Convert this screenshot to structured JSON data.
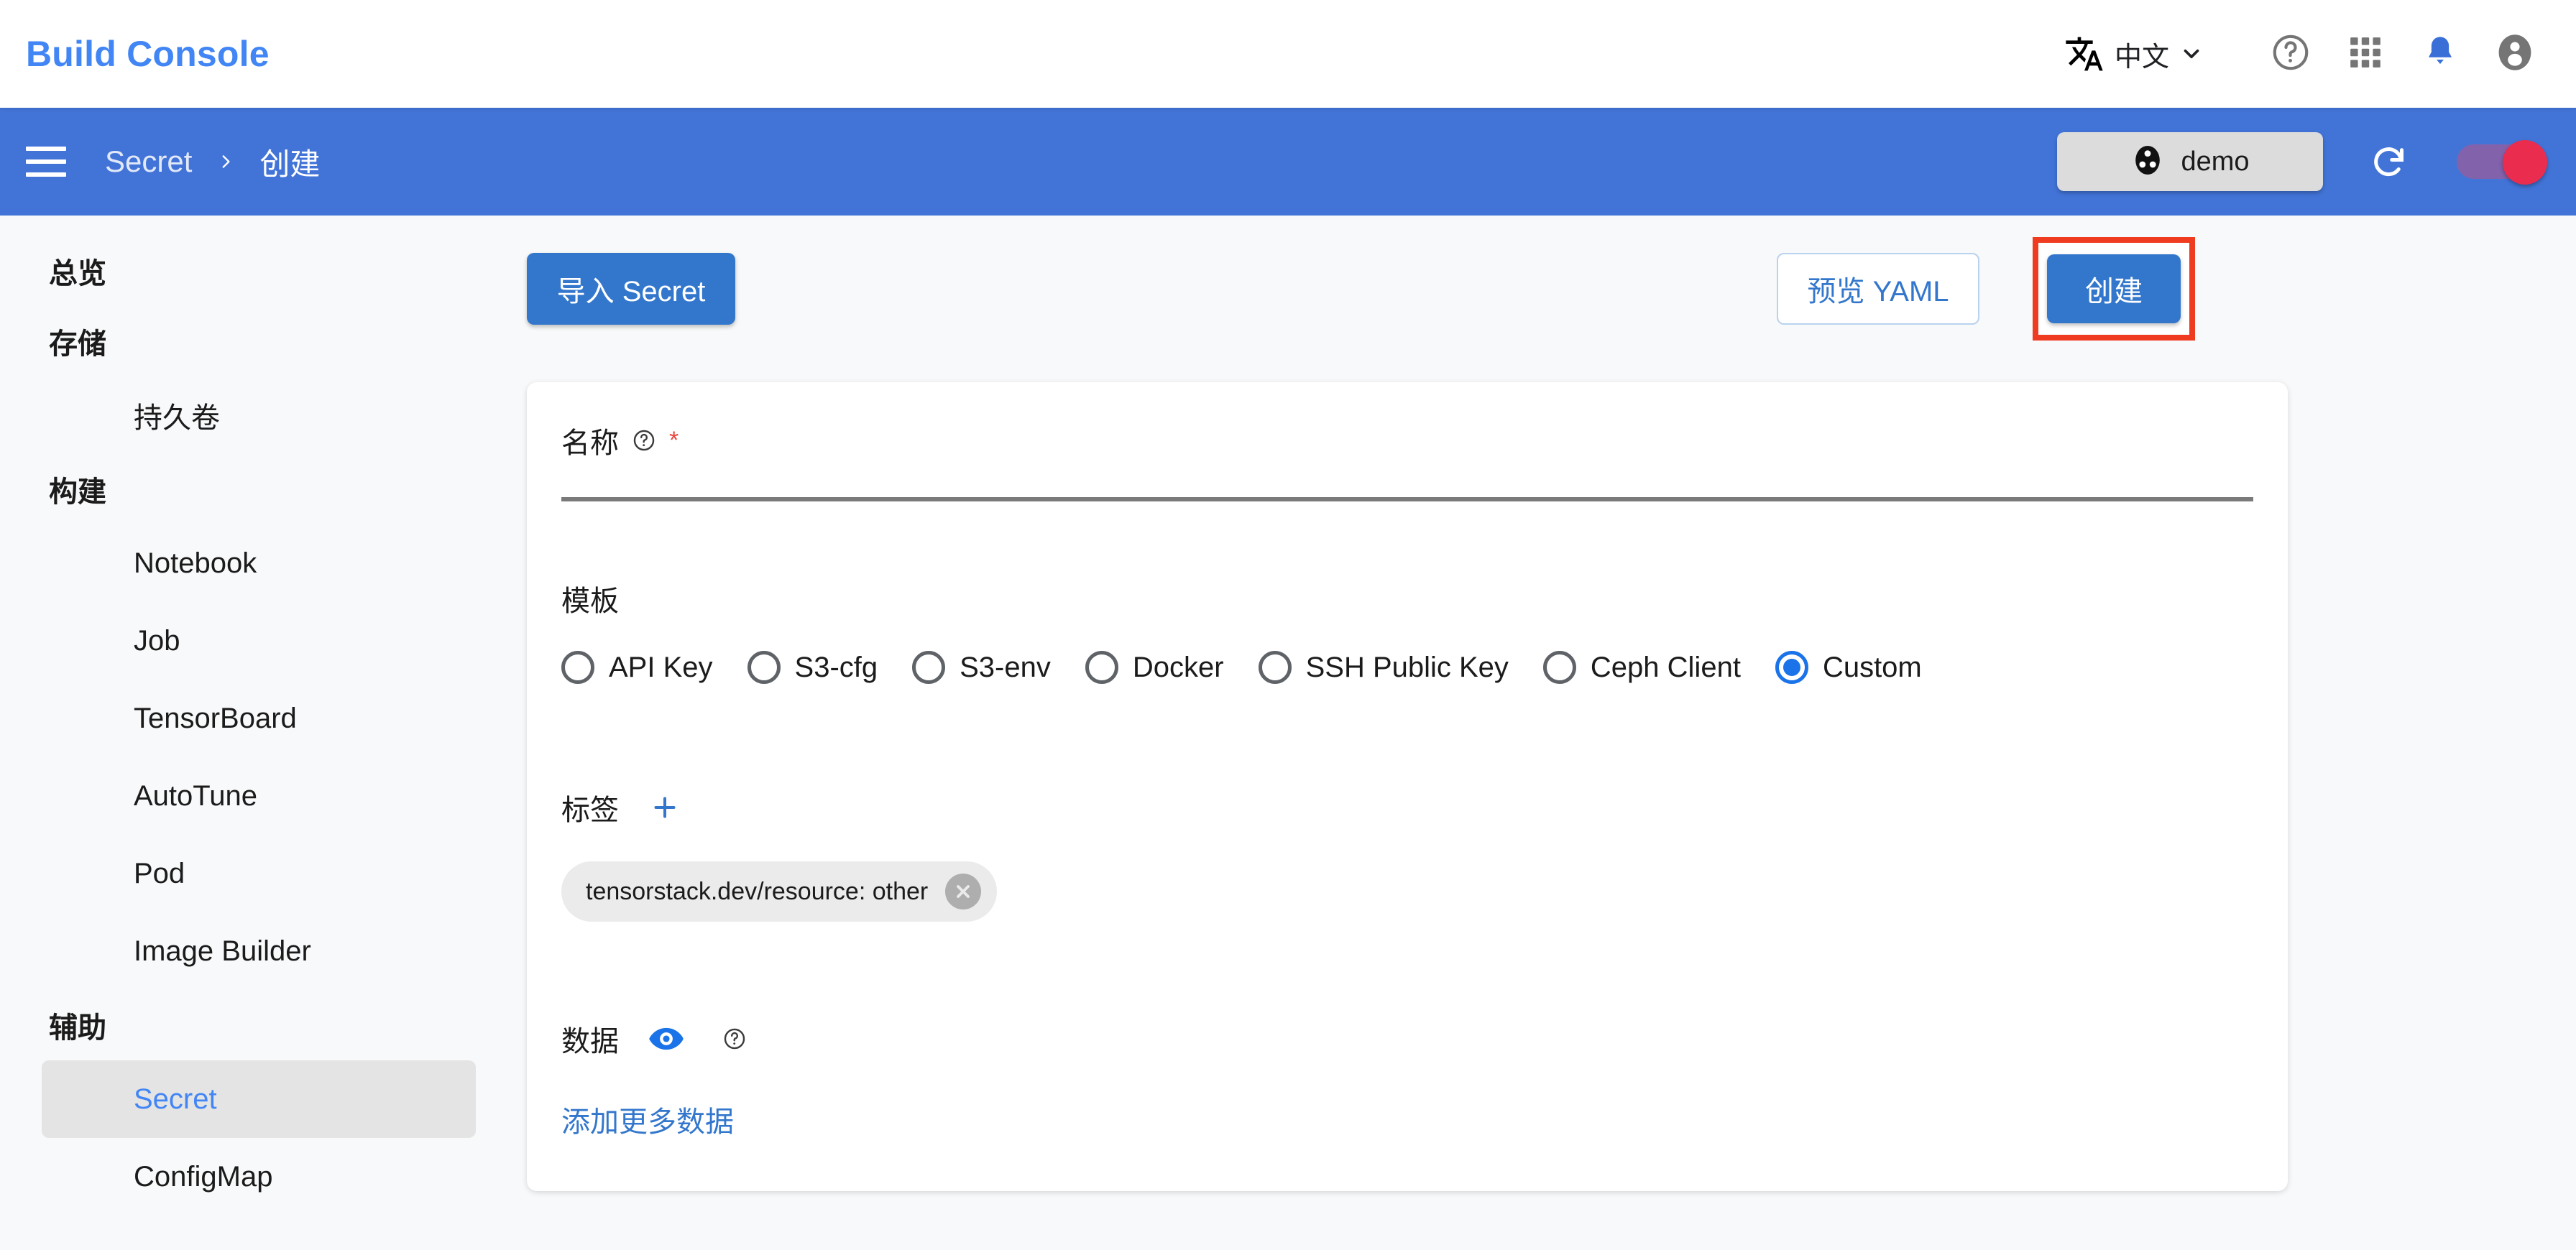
{
  "appbar": {
    "brand": "Build Console",
    "language": {
      "label": "中文",
      "icon": "translate-icon",
      "chevron": "chevron-down-icon"
    },
    "icons": [
      "help-icon",
      "apps-grid-icon",
      "notifications-bell-icon",
      "account-avatar-icon"
    ]
  },
  "bluebar": {
    "menu_icon": "hamburger-menu-icon",
    "breadcrumb": {
      "parent": "Secret",
      "separator": "chevron-right-icon",
      "current": "创建"
    },
    "namespace": {
      "label": "demo",
      "icon": "project-icon"
    },
    "refresh_icon": "refresh-icon",
    "toggle": {
      "state": "on",
      "track_color": "#8e5fa5",
      "thumb_color": "#ea2c4e"
    }
  },
  "sidebar": {
    "items": [
      {
        "label": "总览",
        "type": "group",
        "active": false
      },
      {
        "label": "存储",
        "type": "group",
        "active": false
      },
      {
        "label": "持久卷",
        "type": "item",
        "active": false
      },
      {
        "label": "构建",
        "type": "group",
        "active": false
      },
      {
        "label": "Notebook",
        "type": "item",
        "active": false
      },
      {
        "label": "Job",
        "type": "item",
        "active": false
      },
      {
        "label": "TensorBoard",
        "type": "item",
        "active": false
      },
      {
        "label": "AutoTune",
        "type": "item",
        "active": false
      },
      {
        "label": "Pod",
        "type": "item",
        "active": false
      },
      {
        "label": "Image Builder",
        "type": "item",
        "active": false
      },
      {
        "label": "辅助",
        "type": "group",
        "active": false
      },
      {
        "label": "Secret",
        "type": "item",
        "active": true
      },
      {
        "label": "ConfigMap",
        "type": "item",
        "active": false
      }
    ]
  },
  "toolbar": {
    "import_label": "导入 Secret",
    "preview_label": "预览 YAML",
    "create_label": "创建",
    "create_highlight_color": "#ef3b20"
  },
  "form": {
    "name": {
      "label": "名称",
      "help_icon": "help-circle-icon",
      "required_marker": "*",
      "value": "",
      "placeholder": ""
    },
    "template": {
      "label": "模板",
      "options": [
        {
          "label": "API Key",
          "checked": false
        },
        {
          "label": "S3-cfg",
          "checked": false
        },
        {
          "label": "S3-env",
          "checked": false
        },
        {
          "label": "Docker",
          "checked": false
        },
        {
          "label": "SSH Public Key",
          "checked": false
        },
        {
          "label": "Ceph Client",
          "checked": false
        },
        {
          "label": "Custom",
          "checked": true
        }
      ],
      "selected": "Custom",
      "accent_color": "#1a73e8"
    },
    "labels": {
      "label": "标签",
      "add_icon": "plus-icon",
      "chips": [
        {
          "text": "tensorstack.dev/resource: other",
          "remove_icon": "close-circle-icon"
        }
      ]
    },
    "data": {
      "label": "数据",
      "visibility_icon": "eye-icon",
      "help_icon": "help-circle-icon",
      "add_more_label": "添加更多数据"
    }
  }
}
